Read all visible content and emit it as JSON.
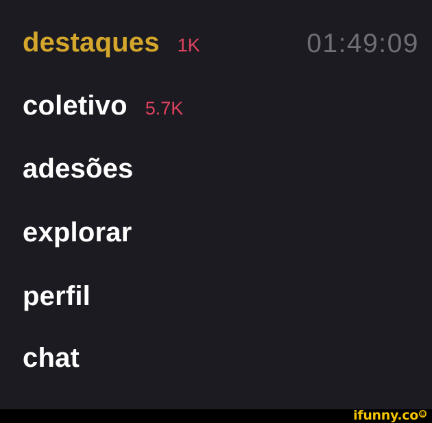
{
  "menu": {
    "items": [
      {
        "label": "destaques",
        "count": "1K"
      },
      {
        "label": "coletivo",
        "count": "5.7K"
      },
      {
        "label": "adesões"
      },
      {
        "label": "explorar"
      },
      {
        "label": "perfil"
      },
      {
        "label": "chat"
      }
    ]
  },
  "clock": "01:49:09",
  "watermark": {
    "text": "ifunny.co"
  },
  "colors": {
    "background": "#1c1b21",
    "active_label": "#d4a72c",
    "label": "#ffffff",
    "count_badge": "#e0425f",
    "clock": "#6f6e76",
    "watermark": "#f6c500"
  }
}
